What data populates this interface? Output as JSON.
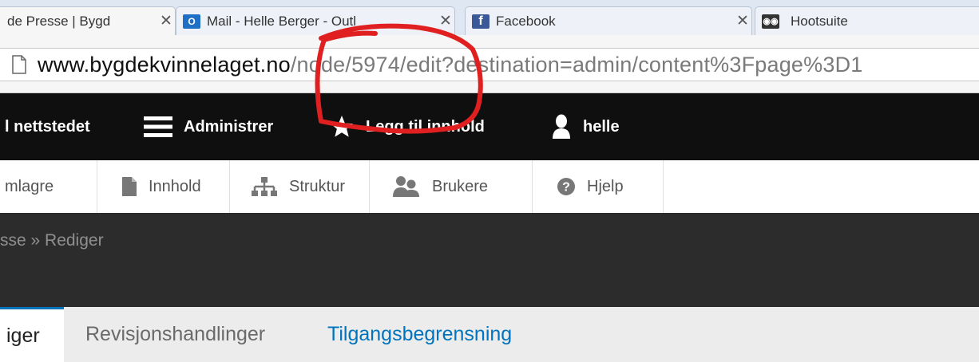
{
  "browser": {
    "tabs": [
      {
        "title": "de Presse | Bygd",
        "favicon": "page-favicon-icon",
        "active": true
      },
      {
        "title": "Mail - Helle Berger - Outl",
        "favicon": "outlook-icon",
        "active": false
      },
      {
        "title": "Facebook",
        "favicon": "facebook-icon",
        "active": false
      },
      {
        "title": "Hootsuite",
        "favicon": "hootsuite-owl-icon",
        "active": false
      }
    ],
    "address": {
      "host": "www.bygdekvinnelaget.no",
      "path": "/node/5974/edit?destination=admin/content%3Fpage%3D1"
    }
  },
  "admin_toolbar": {
    "items": [
      {
        "label": "l nettstedet",
        "icon": ""
      },
      {
        "label": "Administrer",
        "icon": "hamburger-menu-icon"
      },
      {
        "label": "Legg til innhold",
        "icon": "star-icon"
      },
      {
        "label": "helle",
        "icon": "user-icon"
      }
    ]
  },
  "tray": {
    "items": [
      {
        "label": "mlagre",
        "icon": ""
      },
      {
        "label": "Innhold",
        "icon": "document-icon"
      },
      {
        "label": "Struktur",
        "icon": "sitemap-icon"
      },
      {
        "label": "Brukere",
        "icon": "people-icon"
      },
      {
        "label": "Hjelp",
        "icon": "help-icon"
      }
    ]
  },
  "header": {
    "breadcrumb": "sse » Rediger"
  },
  "local_tabs": [
    {
      "label": "iger",
      "active": true
    },
    {
      "label": "Revisjonshandlinger",
      "active": false
    },
    {
      "label": "Tilgangsbegrensning",
      "active": false
    }
  ],
  "colors": {
    "admin_bar": "#0f0f0f",
    "header_dark": "#2c2c2c",
    "tab_link": "#0074bd",
    "annotation": "#e02020"
  }
}
